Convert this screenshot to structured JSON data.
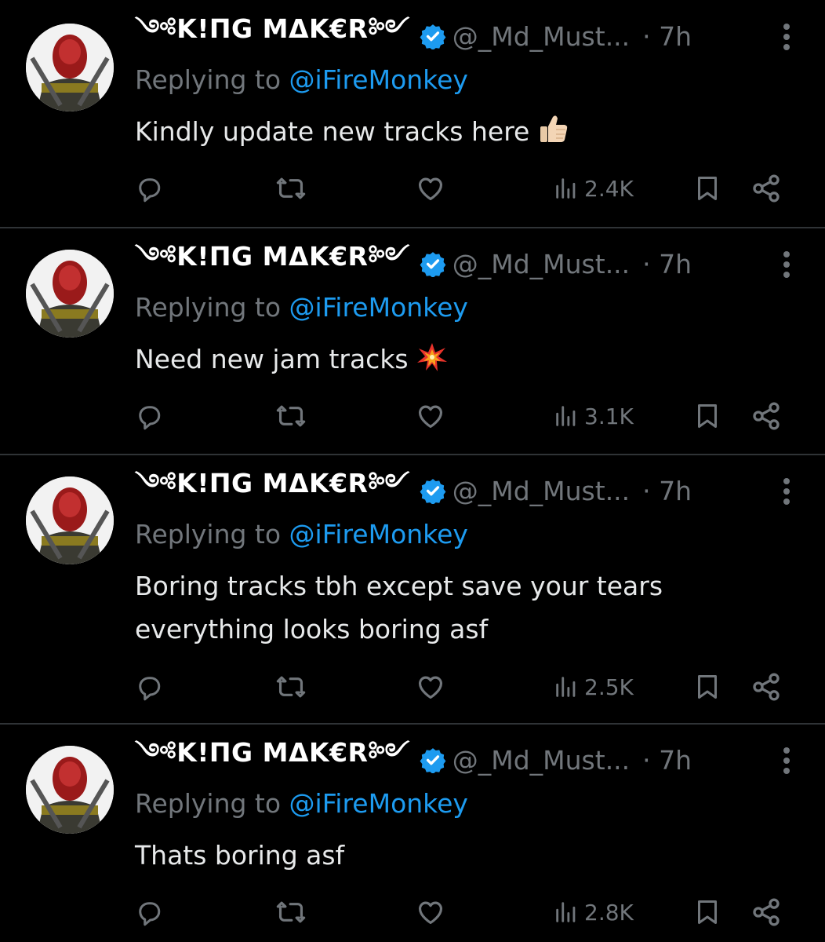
{
  "colors": {
    "background": "#000000",
    "divider": "#2f3336",
    "muted": "#71767b",
    "text": "#e7e9ea",
    "accent": "#1d9bf0"
  },
  "tweets": [
    {
      "display_name": "༺K!ПG MΔK€R༻",
      "handle": "@_Md_Must...",
      "time": "· 7h",
      "replying_prefix": "Replying to ",
      "replying_to": "@iFireMonkey",
      "text": "Kindly update new tracks here",
      "emoji": "thumbs-up-icon",
      "views": "2.4K"
    },
    {
      "display_name": "༺K!ПG MΔK€R༻",
      "handle": "@_Md_Must...",
      "time": "· 7h",
      "replying_prefix": "Replying to ",
      "replying_to": "@iFireMonkey",
      "text": "Need new jam tracks",
      "emoji": "collision-icon",
      "views": "3.1K"
    },
    {
      "display_name": "༺K!ПG MΔK€R༻",
      "handle": "@_Md_Must...",
      "time": "· 7h",
      "replying_prefix": "Replying to ",
      "replying_to": "@iFireMonkey",
      "text_line1": "Boring tracks tbh except save your tears",
      "text_line2": "everything looks boring asf",
      "views": "2.5K"
    },
    {
      "display_name": "༺K!ПG MΔK€R༻",
      "handle": "@_Md_Must...",
      "time": "· 7h",
      "replying_prefix": "Replying to ",
      "replying_to": "@iFireMonkey",
      "text": "Thats boring asf",
      "views": "2.8K"
    }
  ],
  "icons": {
    "reply": "reply-icon",
    "retweet": "retweet-icon",
    "like": "heart-icon",
    "views": "views-chart-icon",
    "bookmark": "bookmark-icon",
    "share": "share-icon",
    "more": "more-vertical-icon",
    "verified": "verified-badge-icon"
  }
}
